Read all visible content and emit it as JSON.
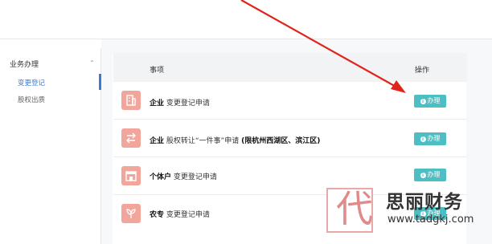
{
  "sidebar": {
    "group_label": "业务办理",
    "items": [
      {
        "label": "变更登记",
        "active": true
      },
      {
        "label": "股权出质",
        "active": false
      }
    ]
  },
  "table": {
    "headers": {
      "item": "事项",
      "action": "操作"
    },
    "rows": [
      {
        "icon": "building-icon",
        "bold_lead": "企业",
        "text": " 变更登记申请",
        "tail_bold": "",
        "action_label": "办理"
      },
      {
        "icon": "transfer-arrows-icon",
        "bold_lead": "企业",
        "text": " 股权转让“一件事”申请 ",
        "tail_bold": "(限杭州西湖区、滨江区)",
        "action_label": "办理"
      },
      {
        "icon": "shop-icon",
        "bold_lead": "个体户",
        "text": " 变更登记申请",
        "tail_bold": "",
        "action_label": "办理"
      },
      {
        "icon": "sprout-icon",
        "bold_lead": "农专",
        "text": " 变更登记申请",
        "tail_bold": "",
        "action_label": "办理"
      }
    ]
  },
  "watermark": {
    "glyph": "代",
    "title": "思丽财务",
    "url": "www.tadgkj.com"
  },
  "colors": {
    "accent": "#3a7bd5",
    "action_button": "#4dbfc4",
    "icon_tile": "#f2a59a",
    "annotation_arrow": "#e0231b"
  }
}
